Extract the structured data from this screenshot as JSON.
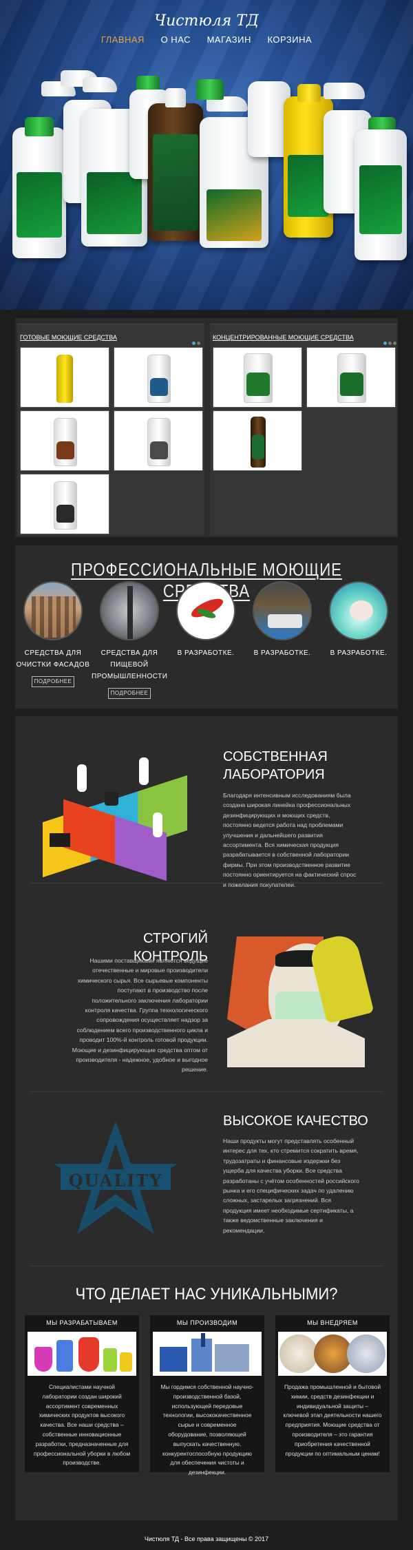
{
  "site": {
    "brand": "Чистюля ТД"
  },
  "nav": {
    "items": [
      "ГЛАВНАЯ",
      "О НАС",
      "МАГАЗИН",
      "КОРЗИНА"
    ],
    "active_color": "#e8a040"
  },
  "catalog": {
    "left_title": "ГОТОВЫЕ МОЮЩИЕ СРЕДСТВА",
    "right_title": "КОНЦЕНТРИРОВАННЫЕ МОЮЩИЕ СРЕДСТВА"
  },
  "professional": {
    "title": "ПРОФЕССИОНАЛЬНЫЕ МОЮЩИЕ СРЕДСТВА",
    "items": [
      {
        "line1": "СРЕДСТВА ДЛЯ",
        "line2": "ОЧИСТКИ ФАСАДОВ",
        "line3": "",
        "button": "ПОДРОБНЕЕ"
      },
      {
        "line1": "СРЕДСТВА ДЛЯ",
        "line2": "ПИЩЕВОЙ",
        "line3": "ПРОМЫШЛЕННОСТИ",
        "button": "ПОДРОБНЕЕ"
      },
      {
        "line1": "В РАЗРАБОТКЕ.",
        "line2": "",
        "line3": "",
        "button": ""
      },
      {
        "line1": "В РАЗРАБОТКЕ.",
        "line2": "",
        "line3": "",
        "button": ""
      },
      {
        "line1": "В РАЗРАБОТКЕ.",
        "line2": "",
        "line3": "",
        "button": ""
      }
    ]
  },
  "about": {
    "lab": {
      "title1": "СОБСТВЕННАЯ",
      "title2": "ЛАБОРАТОРИЯ",
      "lines": [
        "Благодаря интенсивным исследованиям была",
        "создана широкая линейка профессиональных",
        "дезинфицирующих и моющих средств,",
        "постоянно ведется работа над проблемами",
        "улучшения и дальнейшего развития",
        "ассортимента. Вся химическая продукция",
        "разрабатывается в собственной лаборатории",
        "фирмы. При этом производственное развитие",
        "постоянно ориентируется на фактический спрос",
        "и пожелания покупателей."
      ]
    },
    "control": {
      "title": "СТРОГИЙ КОНТРОЛЬ",
      "lines": [
        "Нашими поставщиками являются ведущие",
        "отечественные и мировые производители",
        "химического сырья. Все сырьевые компоненты",
        "поступают в производство после",
        "положительного заключения лаборатории",
        "контроля качества. Группа технологического",
        "сопровождения осуществляет надзор за",
        "соблюдением всего производственного цикла и",
        "проводит 100%-й контроль готовой продукции.",
        "Моющие и дезинфицирующие средства оптом от",
        "производителя - надежное, удобное и выгодное",
        "решение."
      ]
    },
    "quality": {
      "title": "ВЫСОКОЕ КАЧЕСТВО",
      "lines": [
        "Наши продукты могут представлять особенный",
        "интерес для тех, кто стремится сократить время,",
        "трудозатраты и финансовые издержки без",
        "ущерба для качества уборки. Все средства",
        "разработаны с учётом особенностей российского",
        "рынка и его специфических задач по удалению",
        "сложных, застарелых загрязнений. Вся",
        "продукция имеет необходимые сертификаты, а",
        "также ведомственные заключения и",
        "рекомендации."
      ],
      "logo_text": "QUALITY"
    }
  },
  "unique": {
    "title": "ЧТО ДЕЛАЕТ НАС УНИКАЛЬНЫМИ?",
    "cards": [
      {
        "title": "МЫ РАЗРАБАТЫВАЕМ",
        "lines": [
          "Специалистами научной",
          "лаборатории создан широкий",
          "ассортимент современных",
          "химических продуктов высокого",
          "качества. Все наши средства –",
          "собственные инновационные",
          "разработки, предназначенные для",
          "профессиональной уборки в любом",
          "производстве."
        ]
      },
      {
        "title": "МЫ ПРОИЗВОДИМ",
        "lines": [
          "Мы гордимся собственной научно-",
          "производственной базой,",
          "использующей передовые",
          "технологии, высококачественное",
          "сырье и современное",
          "оборудование, позволяющей",
          "выпускать качественную,",
          "конкурентоспособную продукцию",
          "для обеспечения чистоты и",
          "дезинфекции."
        ]
      },
      {
        "title": "МЫ ВНЕДРЯЕМ",
        "lines": [
          "Продажа промышленной и бытовой",
          "химии, средств дезинфекции и",
          "индивидуальной защиты –",
          "ключевой этап деятельности нашего",
          "предприятия. Моющие средства от",
          "производителя – это гарантия",
          "приобретения качественной",
          "продукции по оптимальным ценам!"
        ]
      }
    ]
  },
  "footer": {
    "text": "Чистюля ТД - Все права защищены © 2017"
  }
}
